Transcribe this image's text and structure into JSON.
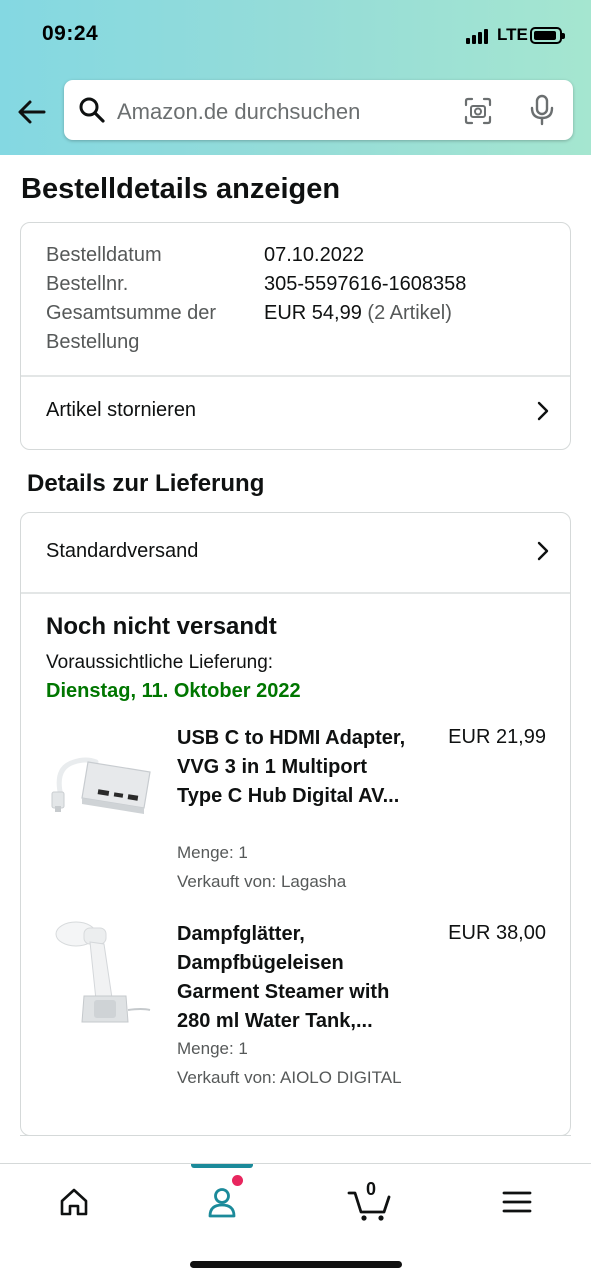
{
  "status_bar": {
    "time": "09:24",
    "network": "LTE"
  },
  "search": {
    "placeholder": "Amazon.de durchsuchen"
  },
  "page_title": "Bestelldetails anzeigen",
  "order": {
    "date_label": "Bestelldatum",
    "date_value": "07.10.2022",
    "number_label": "Bestellnr.",
    "number_value": "305-5597616-1608358",
    "total_label_line1": "Gesamtsumme der",
    "total_label_line2": "Bestellung",
    "total_value": "EUR 54,99",
    "total_count": "(2 Artikel)",
    "cancel_label": "Artikel stornieren"
  },
  "delivery": {
    "section_title": "Details zur Lieferung",
    "shipping_method": "Standardversand",
    "status": "Noch nicht versandt",
    "estimate_label": "Voraussichtliche Lieferung:",
    "estimate_date": "Dienstag, 11. Oktober 2022",
    "items": [
      {
        "title": "USB C to HDMI Adapter, VVG 3 in 1 Multiport Type C Hub Digital AV...",
        "price": "EUR 21,99",
        "quantity": "Menge: 1",
        "seller": "Verkauft von: Lagasha"
      },
      {
        "title": "Dampfglätter, Dampfbügeleisen Garment Steamer with 280 ml Water Tank,...",
        "price": "EUR 38,00",
        "quantity": "Menge: 1",
        "seller": "Verkauft von: AIOLO DIGITAL"
      }
    ]
  },
  "bottom_nav": {
    "items": [
      "home-icon",
      "account-icon",
      "cart-icon",
      "menu-icon"
    ],
    "cart_count": "0",
    "active_color": "#1b8a9a",
    "notification_color": "#e8265e"
  },
  "colors": {
    "delivery_green": "#007600",
    "header_gradient_start": "#84d8e2",
    "header_gradient_end": "#a5e6d0"
  }
}
